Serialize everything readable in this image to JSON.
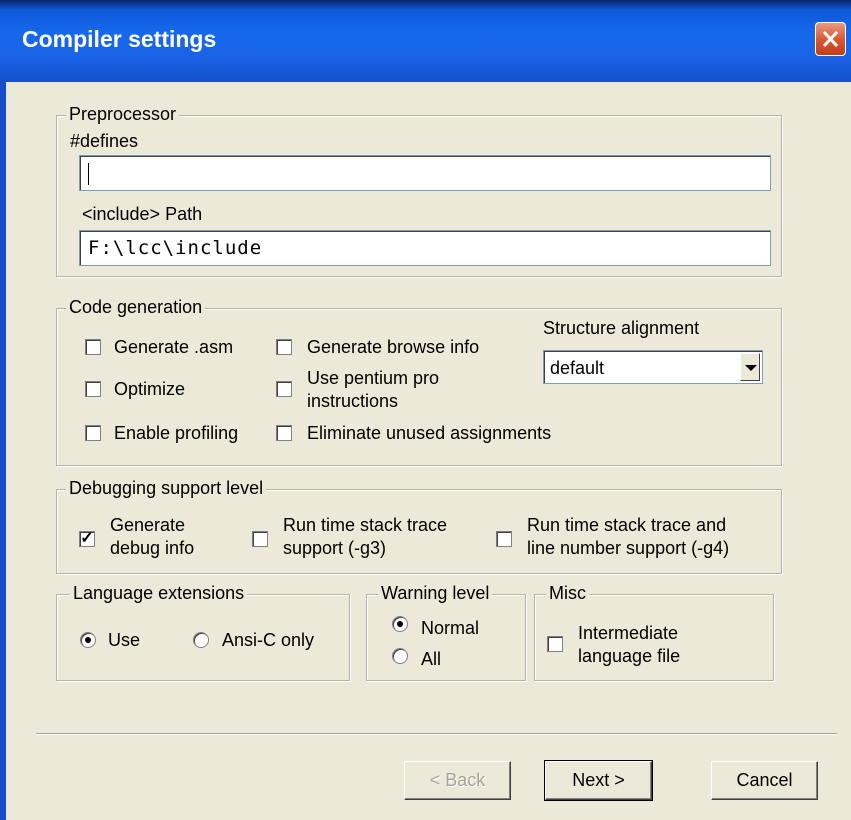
{
  "window": {
    "title": "Compiler settings"
  },
  "preprocessor": {
    "legend": "Preprocessor",
    "defines_label": "#defines",
    "defines_value": "",
    "include_label": "<include> Path",
    "include_value": "F:\\lcc\\include"
  },
  "codegen": {
    "legend": "Code generation",
    "generate_asm": "Generate .asm",
    "generate_browse": "Generate browse info",
    "optimize": "Optimize",
    "pentium_line1": "Use pentium pro",
    "pentium_line2": "instructions",
    "enable_profiling": "Enable profiling",
    "eliminate_unused": "Eliminate unused assignments",
    "structure_alignment_label": "Structure alignment",
    "structure_alignment_value": "default"
  },
  "debugging": {
    "legend": "Debugging support level",
    "generate_debug_line1": "Generate",
    "generate_debug_line2": "debug info",
    "generate_debug_checked": true,
    "g3_line1": "Run time stack trace",
    "g3_line2": "support (-g3)",
    "g4_line1": "Run time stack trace and",
    "g4_line2": "line number support (-g4)"
  },
  "language": {
    "legend": "Language extensions",
    "use": "Use",
    "ansi": "Ansi-C only",
    "selected": "Use"
  },
  "warning": {
    "legend": "Warning level",
    "normal": "Normal",
    "all": "All",
    "selected": "Normal"
  },
  "misc": {
    "legend": "Misc",
    "intermediate_line1": "Intermediate",
    "intermediate_line2": "language file"
  },
  "buttons": {
    "back": "< Back",
    "next": "Next >",
    "cancel": "Cancel"
  },
  "check_mark": "✓"
}
